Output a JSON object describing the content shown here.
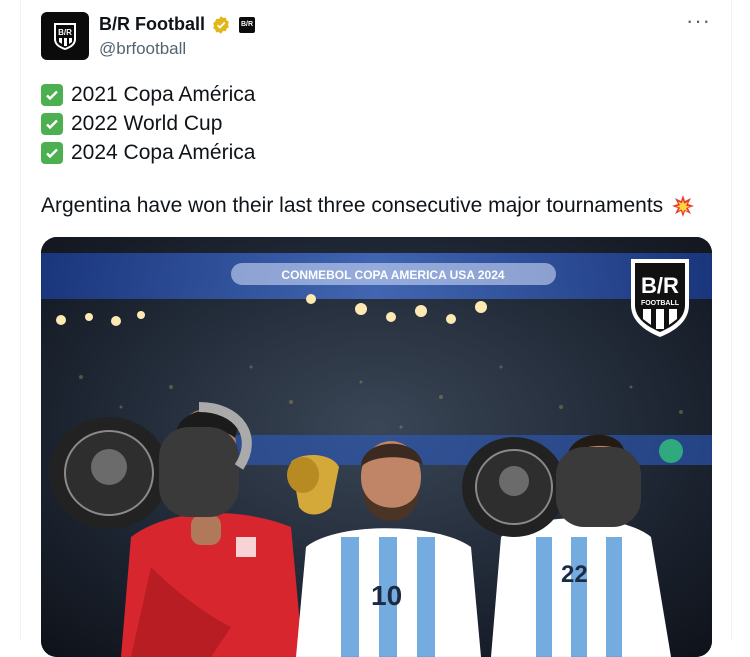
{
  "tweet": {
    "display_name": "B/R Football",
    "handle": "@brfootball",
    "affiliate_badge": "B/R",
    "lines": [
      "2021 Copa América",
      "2022 World Cup",
      "2024 Copa América"
    ],
    "body": "Argentina have won their last three consecutive major tournaments",
    "icons": {
      "verified": "verified-badge-icon",
      "check": "check-mark-button-icon",
      "collision": "collision-emoji-icon",
      "more": "more-options-icon"
    }
  },
  "media": {
    "banner_text": "CONMEBOL COPA AMERICA USA 2024",
    "logo_text": "B/R",
    "logo_sub": "FOOTBALL",
    "player_numbers": [
      "10",
      "22"
    ]
  },
  "colors": {
    "check_green": "#4caf50",
    "verified_gold": "#e2b719",
    "argentina_blue": "#74acdf",
    "keeper_red": "#d7262e"
  }
}
